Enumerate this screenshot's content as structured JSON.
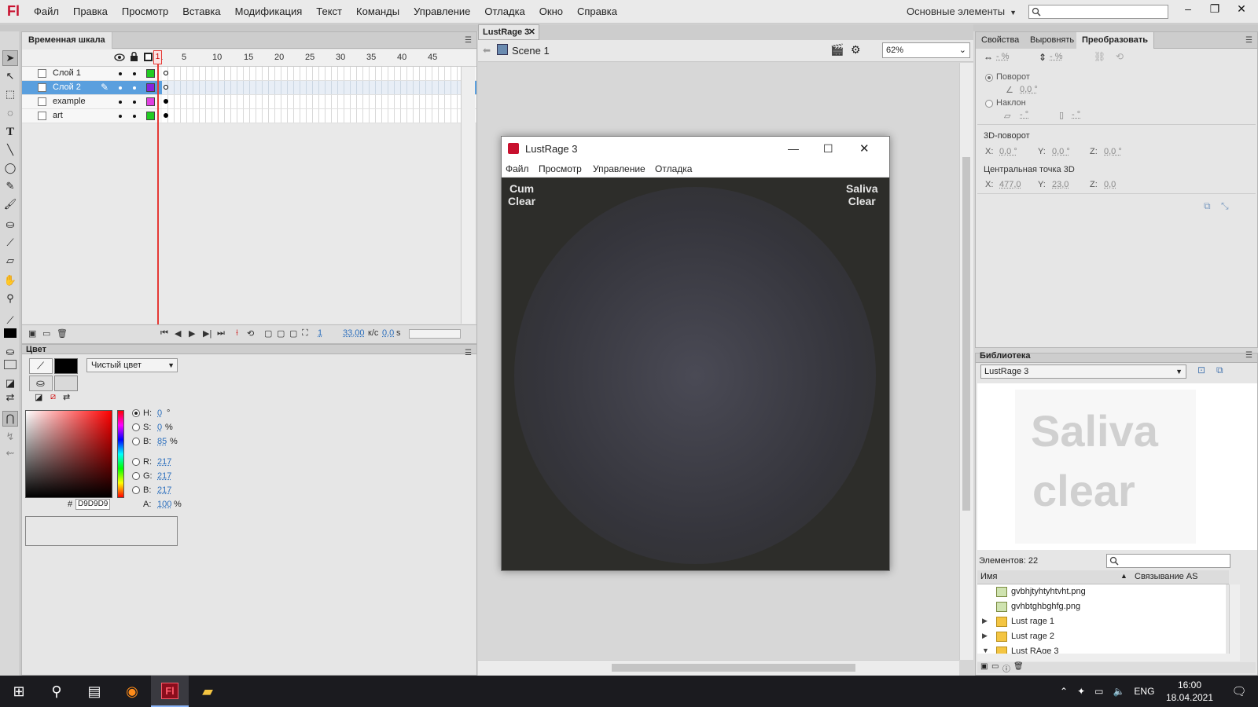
{
  "app": {
    "logo": "Fl",
    "menu": [
      "Файл",
      "Правка",
      "Просмотр",
      "Вставка",
      "Модификация",
      "Текст",
      "Команды",
      "Управление",
      "Отладка",
      "Окно",
      "Справка"
    ],
    "workspace": "Основные элементы",
    "window_buttons": [
      "–",
      "❐",
      "✕"
    ]
  },
  "timeline": {
    "tab": "Временная шкала",
    "ruler": [
      "1",
      "5",
      "10",
      "15",
      "20",
      "25",
      "30",
      "35",
      "40",
      "45"
    ],
    "layers": [
      {
        "name": "Слой 1",
        "color": "#22cc22",
        "selected": false
      },
      {
        "name": "Слой 2",
        "color": "#8822dd",
        "selected": true
      },
      {
        "name": "example",
        "color": "#e040e0",
        "selected": false
      },
      {
        "name": "art",
        "color": "#22cc22",
        "selected": false
      }
    ],
    "current_frame": "1",
    "fps": "33,00",
    "fps_unit": "к/с",
    "time": "0,0",
    "time_unit": "s"
  },
  "color": {
    "tab": "Цвет",
    "fill_type": "Чистый цвет",
    "H": "0",
    "H_unit": "°",
    "S": "0",
    "S_unit": "%",
    "B": "85",
    "B_unit": "%",
    "R": "217",
    "G": "217",
    "B2": "217",
    "A": "100",
    "A_unit": "%",
    "hex_label": "#",
    "hex": "D9D9D9",
    "fill_color": "#D9D9D9"
  },
  "document": {
    "tab": "LustRage 3",
    "scene": "Scene 1",
    "zoom": "62%"
  },
  "player": {
    "title": "LustRage 3",
    "menu": [
      "Файл",
      "Просмотр",
      "Управление",
      "Отладка"
    ],
    "corner_left": [
      "Cum",
      "Clear"
    ],
    "corner_right": [
      "Saliva",
      "Clear"
    ]
  },
  "props": {
    "tabs": [
      "Свойства",
      "Выровнять",
      "Преобразовать"
    ],
    "scale_w": "- %",
    "scale_h": "- %",
    "rotate_label": "Поворот",
    "rotate_val": "0,0 °",
    "skew_label": "Наклон",
    "skew_x": "- °",
    "skew_y": "- °",
    "rotate3d_label": "3D-поворот",
    "r3d_x_label": "X:",
    "r3d_x": "0,0 °",
    "r3d_y_label": "Y:",
    "r3d_y": "0,0 °",
    "r3d_z_label": "Z:",
    "r3d_z": "0,0 °",
    "center3d_label": "Центральная точка 3D",
    "c3d_x_label": "X:",
    "c3d_x": "477,0",
    "c3d_y_label": "Y:",
    "c3d_y": "23,0",
    "c3d_z_label": "Z:",
    "c3d_z": "0,0"
  },
  "library": {
    "tab": "Библиотека",
    "doc": "LustRage 3",
    "preview_line1": "Saliva",
    "preview_line2": "clear",
    "count": "Элементов: 22",
    "col_name": "Имя",
    "col_link": "Связывание AS",
    "items": [
      {
        "name": "gvbhjtyhtyhtvht.png",
        "kind": "img",
        "arrow": ""
      },
      {
        "name": "gvhbtghbghfg.png",
        "kind": "img",
        "arrow": ""
      },
      {
        "name": "Lust rage 1",
        "kind": "folder",
        "arrow": "▶"
      },
      {
        "name": "Lust rage 2",
        "kind": "folder",
        "arrow": "▶"
      },
      {
        "name": "Lust RAge 3",
        "kind": "folder",
        "arrow": "▼"
      }
    ]
  },
  "taskbar": {
    "lang": "ENG",
    "time": "16:00",
    "date": "18.04.2021"
  }
}
